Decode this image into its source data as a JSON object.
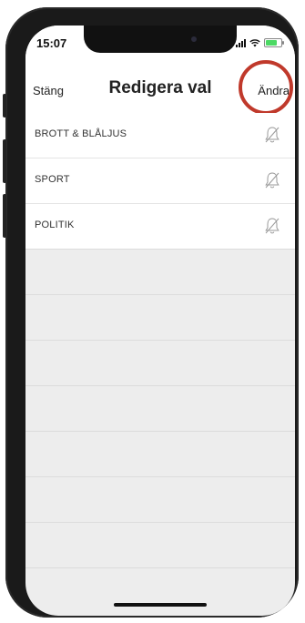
{
  "status_bar": {
    "time": "15:07"
  },
  "navbar": {
    "close_label": "Stäng",
    "title": "Redigera val",
    "edit_label": "Ändra"
  },
  "list": {
    "items": [
      {
        "label": "BROTT & BLÅLJUS",
        "icon": "bell-off-icon"
      },
      {
        "label": "SPORT",
        "icon": "bell-off-icon"
      },
      {
        "label": "POLITIK",
        "icon": "bell-off-icon"
      }
    ]
  },
  "colors": {
    "highlight": "#c0392b",
    "background": "#ededed",
    "text": "#222222"
  }
}
